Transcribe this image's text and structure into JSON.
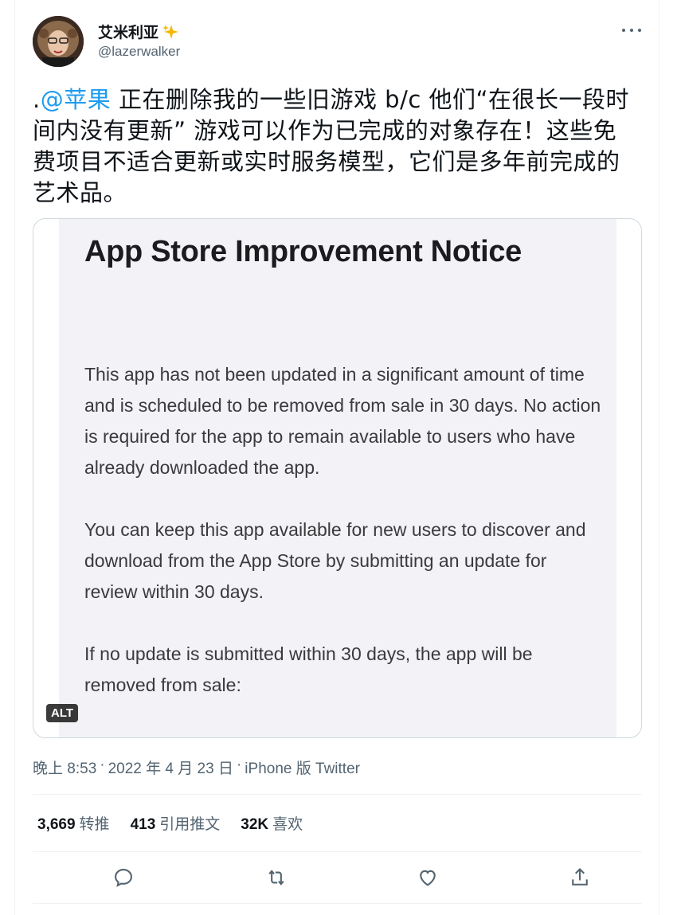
{
  "author": {
    "display_name": "艾米利亚",
    "handle": "@lazerwalker"
  },
  "tweet": {
    "prefix": ".",
    "mention": "@苹果",
    "body": " 正在删除我的一些旧游戏 b/c 他们“在很长一段时间内没有更新” 游戏可以作为已完成的对象存在！这些免费项目不适合更新或实时服务模型，它们是多年前完成的艺术品。"
  },
  "media": {
    "title": "App Store Improvement Notice",
    "paragraphs": [
      "This app has not been updated in a significant amount of time and is scheduled to be removed from sale in 30 days. No action is required for the app to remain available to users who have already downloaded the app.",
      "You can keep this app available for new users to discover and download from the App Store by submitting an update for review within 30 days.",
      "If no update is submitted within 30 days, the app will be removed from sale:"
    ],
    "alt_label": "ALT"
  },
  "meta": {
    "time": "晚上 8:53",
    "sep1": "·",
    "date": "2022 年 4 月 23 日",
    "sep2": "·",
    "source": "iPhone 版 Twitter"
  },
  "stats": [
    {
      "count": "3,669",
      "label": "转推"
    },
    {
      "count": "413",
      "label": "引用推文"
    },
    {
      "count": "32K",
      "label": "喜欢"
    }
  ],
  "icons": {
    "reply": "reply-icon",
    "retweet": "retweet-icon",
    "like": "heart-icon",
    "share": "share-icon",
    "more": "more-icon",
    "sparkle": "sparkle-icon"
  },
  "colors": {
    "accent": "#1d9bf0",
    "secondary_text": "#536471",
    "primary_text": "#0f1419"
  }
}
